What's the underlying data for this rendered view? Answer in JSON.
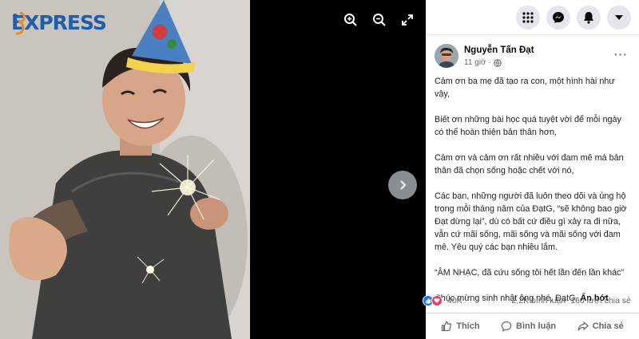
{
  "brand": {
    "name": "EXPRESS",
    "logo_icon": "35express-logo-icon",
    "color": "#1f5fa9"
  },
  "viewer": {
    "controls": [
      {
        "name": "zoom-in-icon"
      },
      {
        "name": "zoom-out-icon"
      },
      {
        "name": "fullscreen-icon"
      }
    ],
    "next_icon": "chevron-right-icon",
    "photo_alt": "photo-of-man-in-party-hat-with-sparkler"
  },
  "topbar": {
    "buttons": [
      {
        "name": "menu-grid-icon"
      },
      {
        "name": "messenger-icon"
      },
      {
        "name": "notifications-bell-icon"
      },
      {
        "name": "account-dropdown-icon"
      }
    ]
  },
  "post": {
    "author": "Nguyễn Tấn Đạt",
    "time": "11 giờ",
    "paragraphs": [
      "Cảm ơn ba mẹ đã tạo ra con, một hình hài như vậy,",
      "Biết ơn những bài học quá tuyệt vời để mỗi ngày có thể hoàn thiện bản thân hơn,",
      "Cảm ơn và cảm ơn rất nhiều với đam mê mà bản thân đã chọn sống hoặc chết với nó,",
      "Các bạn, những người đã luôn theo dõi và ủng hộ trong mỗi tháng năm của ĐạtG, “sẽ không bao giờ Đạt dừng lại”, dù có bất cứ điều gì xảy ra đi nữa, vẫn cứ mãi sống, mãi sống và mãi sống với đam mê. Yêu quý các bạn nhiều lắm.",
      "“ÂM NHẠC, đã cứu sống tôi hết lần đến lần khác”"
    ],
    "last_line": "Chúc mừng sinh nhật ông nhé, ĐạtG.",
    "see_less": "Ẩn bớt",
    "reaction_count": "40K",
    "comments": "2,2K bình luận",
    "shares": "160 lượt chia sẻ",
    "actions": {
      "like": "Thích",
      "comment": "Bình luận",
      "share": "Chia sẻ"
    }
  },
  "colors": {
    "fb_blue": "#1877f2",
    "love_red": "#f33e58",
    "muted": "#65676b"
  }
}
